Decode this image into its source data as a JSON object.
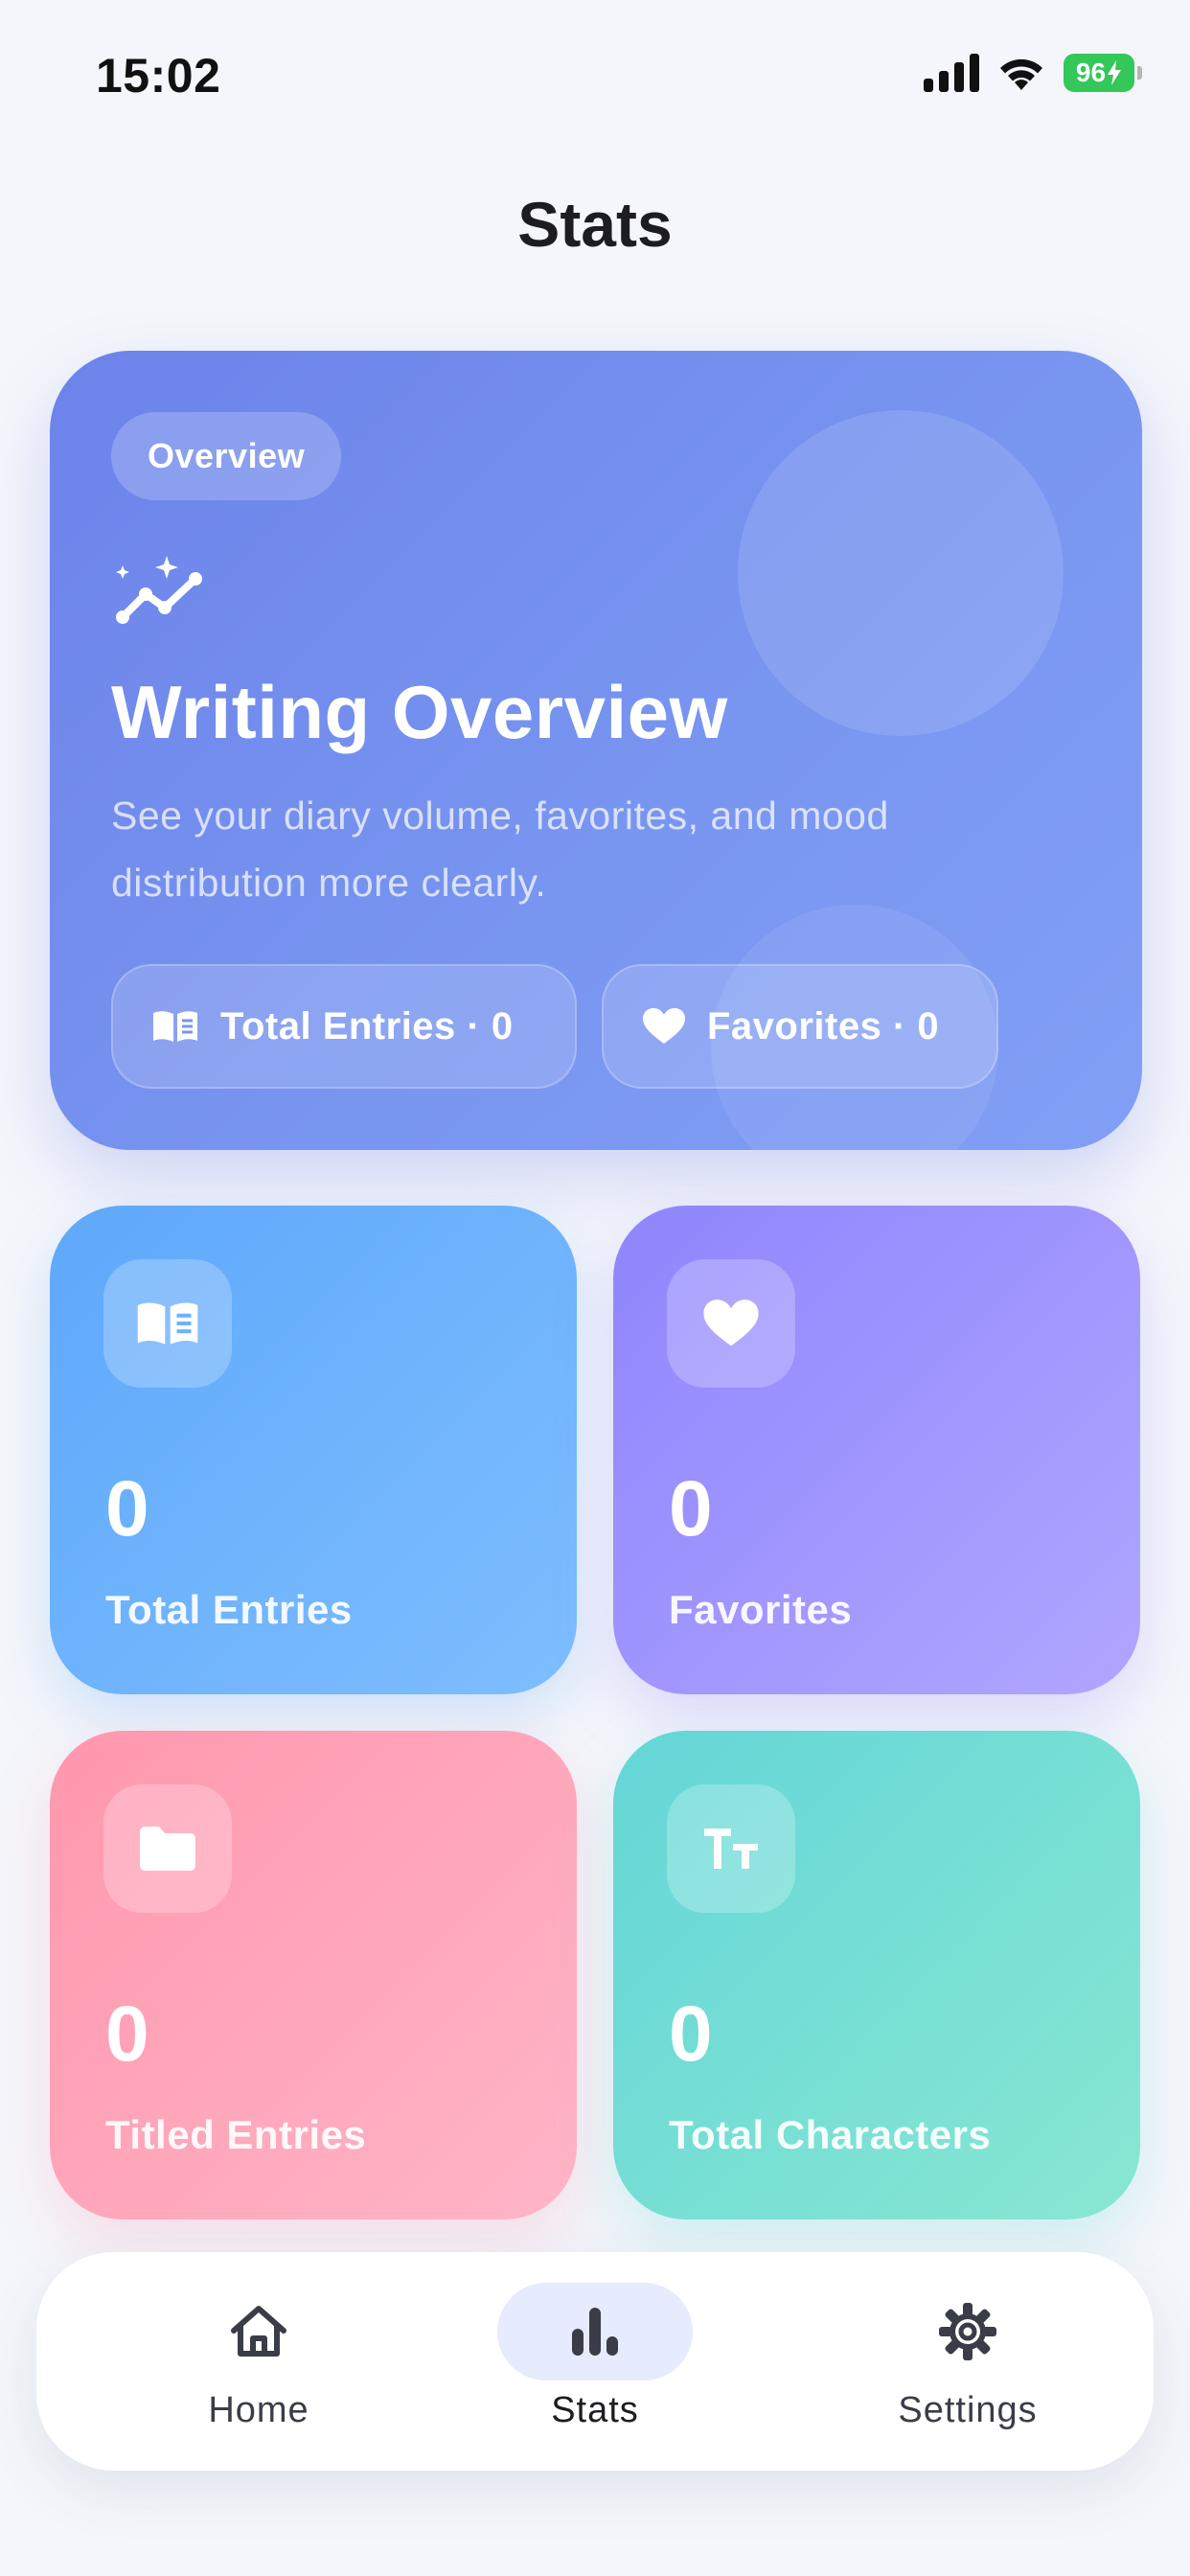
{
  "status_bar": {
    "time": "15:02",
    "battery": "96"
  },
  "page": {
    "title": "Stats"
  },
  "overview": {
    "badge": "Overview",
    "title": "Writing Overview",
    "description": "See your diary volume, favorites, and mood distribution more clearly.",
    "chips": {
      "entries": "Total Entries · 0",
      "favorites": "Favorites · 0"
    },
    "icon": "sparkle-trend-icon"
  },
  "stats": {
    "total_entries": {
      "value": "0",
      "label": "Total Entries",
      "icon": "book-icon",
      "color": "#5ea8fb"
    },
    "favorites": {
      "value": "0",
      "label": "Favorites",
      "icon": "heart-icon",
      "color": "#8f85fd"
    },
    "titled_entries": {
      "value": "0",
      "label": "Titled Entries",
      "icon": "folder-icon",
      "color": "#ff97ae"
    },
    "total_characters": {
      "value": "0",
      "label": "Total Characters",
      "icon": "text-size-icon",
      "color": "#64d6d7"
    }
  },
  "tabs": {
    "home": {
      "label": "Home",
      "icon": "house-icon"
    },
    "stats": {
      "label": "Stats",
      "icon": "bar-chart-icon",
      "active": true
    },
    "settings": {
      "label": "Settings",
      "icon": "gear-icon"
    }
  },
  "colors": {
    "accent": "#6c83ea",
    "active_tab_bg": "#e6ebfd",
    "battery": "#34c759"
  }
}
